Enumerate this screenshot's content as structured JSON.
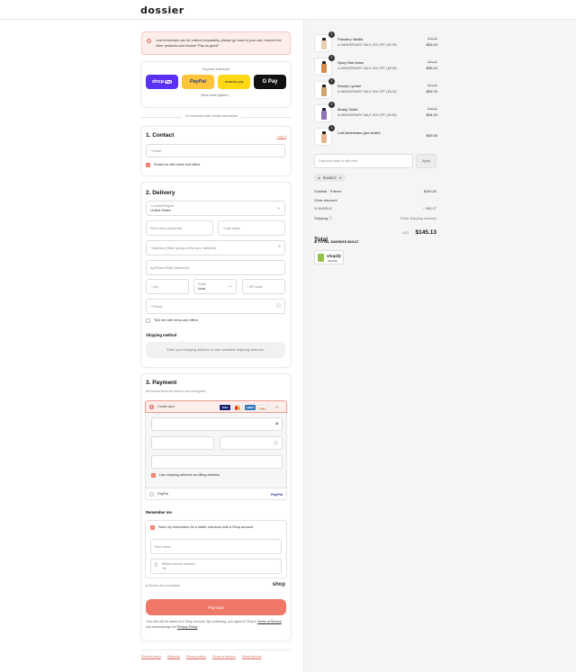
{
  "brand": {
    "logo": "dossier"
  },
  "alert": {
    "text": "Lost Americans can be ordered separately, please go back to your cart, remove the other products and choose \"Pay as guest\""
  },
  "express": {
    "title": "Express checkout",
    "buttons": [
      {
        "label": "shop",
        "badge": "Pay"
      },
      {
        "label": "PayPal"
      },
      {
        "label": "amazon pay"
      },
      {
        "label": "G Pay"
      }
    ],
    "show_more": "Show more options ⌄",
    "or_text": "Or checkout with credit card below"
  },
  "contact": {
    "title": "1. Contact",
    "login": "Log in",
    "email_placeholder": "* Email",
    "email_news": "Email me with news and offers"
  },
  "delivery": {
    "title": "2. Delivery",
    "country_label": "Country/Region",
    "country_value": "United States",
    "first_name": "First name (optional)",
    "last_name": "* Last name",
    "address": "* Address (Start typing to find your address)",
    "apt": "Apt/Floor/Suite (Optional)",
    "city": "* City",
    "state_label": "State",
    "state_value": "Iowa",
    "zip": "* ZIP code",
    "phone": "* Phone",
    "text_news": "Text me with news and offers",
    "shipping_method_title": "Shipping method",
    "shipping_method_note": "Enter your shipping address to view available shipping methods."
  },
  "payment": {
    "title": "3. Payment",
    "subtitle": "All transactions are secure and encrypted.",
    "credit_card": "Credit card",
    "card_brands": [
      "VISA",
      "MC",
      "AMEX",
      "DISC"
    ],
    "more_brands": "+5",
    "billing_same": "Use shipping address as billing address",
    "paypal": "PayPal",
    "paypal_mark": "PayPal"
  },
  "remember": {
    "title": "Remember me",
    "save_info": "Save my information for a faster checkout with a Shop account",
    "first_name": "First name",
    "mobile_label": "Mobile phone number",
    "mobile_prefix": "+1",
    "secure": "Secure and encrypted",
    "shop_mark": "shop"
  },
  "pay_now": "Pay now",
  "legal": {
    "prefix": "Your info will be saved to a Shop account. By continuing, you agree to Shop's",
    "terms": "Terms of Service",
    "middle": "and acknowledge the",
    "privacy": "Privacy Policy"
  },
  "footer_links": [
    "Refund policy",
    "Shipping",
    "Privacy policy",
    "Terms of service",
    "Subscriptions"
  ],
  "summary": {
    "products": [
      {
        "qty": "1",
        "name": "Powdery Vanilla",
        "discount": "ANNIVERSARY SALE 10% OFF (-$2.90)",
        "old_price": "$29.00",
        "price": "$26.10",
        "bottle": "#e8d3b0"
      },
      {
        "qty": "1",
        "name": "Spicy Star Anise",
        "discount": "ANNIVERSARY SALE 10% OFF (-$3.90)",
        "old_price": "$39.00",
        "price": "$35.10",
        "bottle": "#d58a4b"
      },
      {
        "qty": "1",
        "name": "Woody Lychee",
        "discount": "ANNIVERSARY SALE 10% OFF (-$3.30)",
        "old_price": "$33.00",
        "price": "$29.70",
        "bottle": "#cfa76d"
      },
      {
        "qty": "1",
        "name": "Musky Violet",
        "discount": "ANNIVERSARY SALE 10% OFF (-$4.90)",
        "old_price": "$49.00",
        "price": "$44.10",
        "bottle": "#8f72b8"
      },
      {
        "qty": "1",
        "name": "Lost Americans (pre-order)",
        "discount": "",
        "old_price": "",
        "price": "$49.00",
        "bottle": "#e9b48d"
      }
    ],
    "discount_placeholder": "Discount code or gift card",
    "apply": "Apply",
    "bundle_chip": "BUNDLE",
    "subtotal_label": "Subtotal · 5 items",
    "subtotal": "$160.50",
    "order_discount_label": "Order discount",
    "bundle_label": "BUNDLE",
    "bundle_value": "− $48.27",
    "shipping_label": "Shipping",
    "shipping_value": "Enter shipping address",
    "total_label": "Total",
    "currency": "USD",
    "total": "$145.13",
    "savings": "TOTAL SAVINGS  $63.67",
    "shopify_word": "shopify",
    "shopify_sub": "SECURE"
  }
}
